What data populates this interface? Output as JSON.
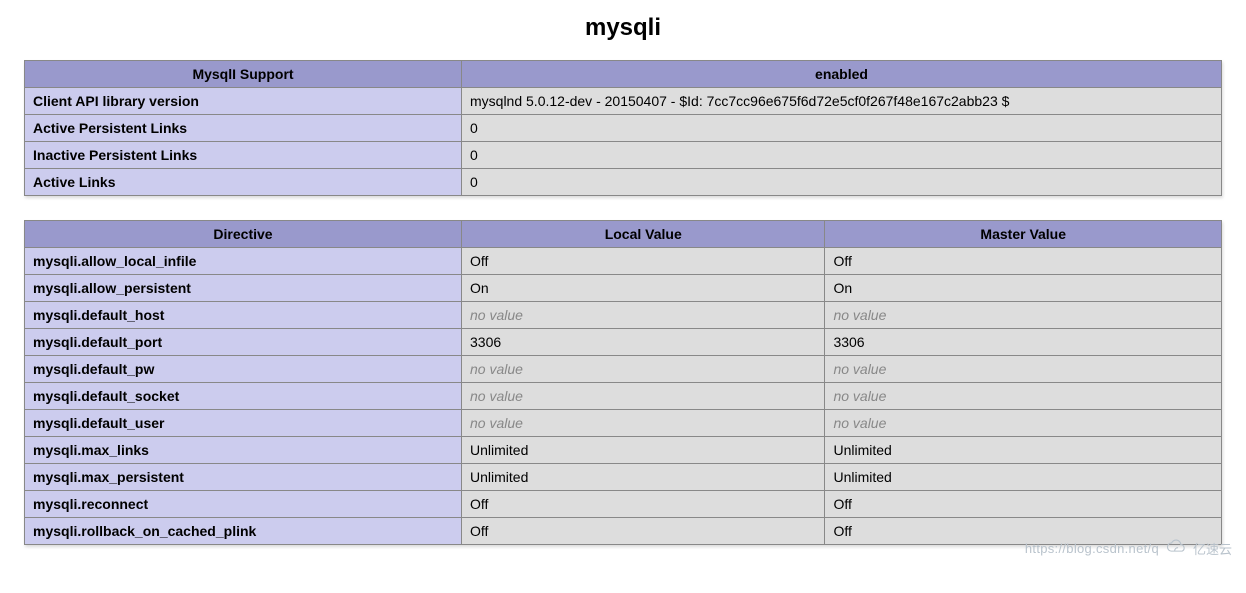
{
  "title": "mysqli",
  "info_table": {
    "headers": [
      "MysqlI Support",
      "enabled"
    ],
    "rows": [
      {
        "key": "Client API library version",
        "value": "mysqlnd 5.0.12-dev - 20150407 - $Id: 7cc7cc96e675f6d72e5cf0f267f48e167c2abb23 $"
      },
      {
        "key": "Active Persistent Links",
        "value": "0"
      },
      {
        "key": "Inactive Persistent Links",
        "value": "0"
      },
      {
        "key": "Active Links",
        "value": "0"
      }
    ]
  },
  "directives_table": {
    "headers": [
      "Directive",
      "Local Value",
      "Master Value"
    ],
    "no_value_text": "no value",
    "rows": [
      {
        "directive": "mysqli.allow_local_infile",
        "local": "Off",
        "master": "Off"
      },
      {
        "directive": "mysqli.allow_persistent",
        "local": "On",
        "master": "On"
      },
      {
        "directive": "mysqli.default_host",
        "local": null,
        "master": null
      },
      {
        "directive": "mysqli.default_port",
        "local": "3306",
        "master": "3306"
      },
      {
        "directive": "mysqli.default_pw",
        "local": null,
        "master": null
      },
      {
        "directive": "mysqli.default_socket",
        "local": null,
        "master": null
      },
      {
        "directive": "mysqli.default_user",
        "local": null,
        "master": null
      },
      {
        "directive": "mysqli.max_links",
        "local": "Unlimited",
        "master": "Unlimited"
      },
      {
        "directive": "mysqli.max_persistent",
        "local": "Unlimited",
        "master": "Unlimited"
      },
      {
        "directive": "mysqli.reconnect",
        "local": "Off",
        "master": "Off"
      },
      {
        "directive": "mysqli.rollback_on_cached_plink",
        "local": "Off",
        "master": "Off"
      }
    ]
  },
  "watermark": {
    "url": "https://blog.csdn.net/q",
    "brand": "亿速云"
  }
}
